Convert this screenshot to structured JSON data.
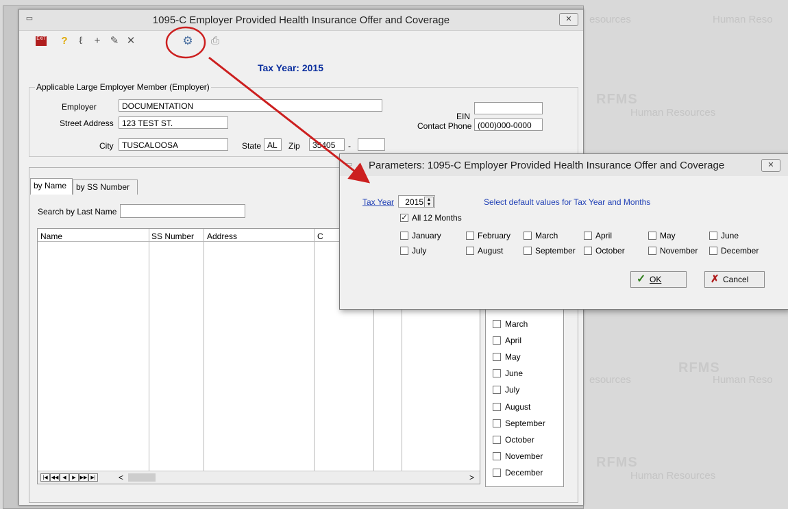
{
  "watermark": {
    "brand": "RFMS",
    "line1": "Human Resources",
    "line2": "Human Reso",
    "frag_resources": "esources",
    "frag_ma": "ma",
    "frag_es": "es"
  },
  "main_window": {
    "title": "1095-C Employer Provided Health Insurance Offer and Coverage",
    "close_glyph": "✕",
    "toolbar": [
      {
        "name": "exit-icon",
        "glyph": "EXIT"
      },
      {
        "name": "help-icon",
        "glyph": "?"
      },
      {
        "name": "wand-icon",
        "glyph": "ℓ"
      },
      {
        "name": "add-icon",
        "glyph": "+"
      },
      {
        "name": "edit-icon",
        "glyph": "✎"
      },
      {
        "name": "delete-icon",
        "glyph": "✕"
      },
      {
        "name": "parameters-gears-icon",
        "glyph": "⚙"
      },
      {
        "name": "print-icon",
        "glyph": "⎙"
      }
    ],
    "tax_year_label": "Tax Year: 2015",
    "employer_group": {
      "title": "Applicable Large Employer Member (Employer)",
      "employer_label": "Employer",
      "employer_value": "DOCUMENTATION",
      "street_label": "Street Address",
      "street_value": "123 TEST ST.",
      "city_label": "City",
      "city_value": "TUSCALOOSA",
      "state_label": "State",
      "state_value": "AL",
      "zip_label": "Zip",
      "zip_value": "35405",
      "zip_dash": "-",
      "zip_ext_value": "",
      "ein_label": "EIN",
      "ein_value": "",
      "contact_label": "Contact Phone",
      "contact_value": "(000)000-0000"
    },
    "tabs": [
      "by Name",
      "by SS Number"
    ],
    "search_label": "Search by Last Name",
    "search_value": "",
    "grid_headers": [
      "Name",
      "SS Number",
      "Address",
      "C"
    ],
    "nav_buttons": [
      "|◀",
      "◀◀",
      "◀",
      "▶",
      "▶▶",
      "▶|"
    ],
    "scroll_left": "<",
    "scroll_right": ">",
    "months_list": [
      "March",
      "April",
      "May",
      "June",
      "July",
      "August",
      "September",
      "October",
      "November",
      "December"
    ]
  },
  "dialog": {
    "title": "Parameters: 1095-C Employer Provided Health Insurance Offer and Coverage",
    "close_glyph": "✕",
    "tax_year_label": "Tax Year",
    "tax_year_value": "2015",
    "hint": "Select default values for Tax Year and Months",
    "all_months_label": "All 12 Months",
    "all_months_checked": true,
    "months": [
      "January",
      "February",
      "March",
      "April",
      "May",
      "June",
      "July",
      "August",
      "September",
      "October",
      "November",
      "December"
    ],
    "ok_label": "OK",
    "cancel_label": "Cancel"
  },
  "colors": {
    "annotation_red": "#cc1f1f",
    "tax_year_blue": "#0a2e9e",
    "dialog_link_blue": "#1f3fb5"
  }
}
